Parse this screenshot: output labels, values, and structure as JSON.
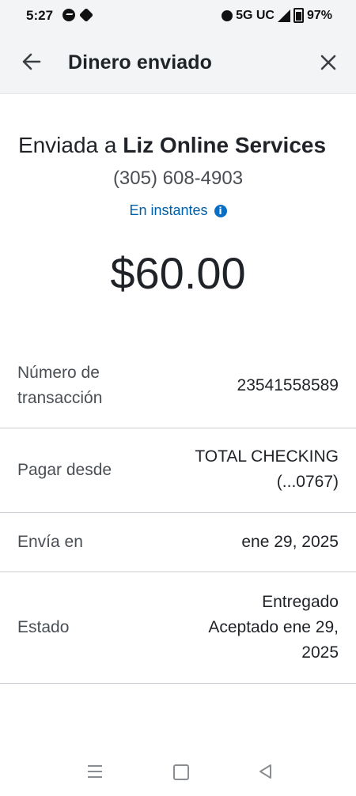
{
  "status_bar": {
    "time": "5:27",
    "network": "5G UC",
    "battery": "97%"
  },
  "header": {
    "title": "Dinero enviado"
  },
  "recipient": {
    "prefix": "Enviada a ",
    "name": "Liz Online Services",
    "phone": "(305) 608-4903",
    "speed": "En instantes",
    "info_icon": "i"
  },
  "amount": "$60.00",
  "details": [
    {
      "label_line1": "Número de",
      "label_line2": "transacción",
      "value": "23541558589"
    },
    {
      "label": "Pagar desde",
      "value_line1": "TOTAL CHECKING",
      "value_line2": "(...0767)"
    },
    {
      "label": "Envía en",
      "value": "ene 29, 2025"
    },
    {
      "label": "Estado",
      "value_line1": "Entregado",
      "value_line2": "Aceptado ene 29,",
      "value_line3": "2025"
    }
  ],
  "colors": {
    "link": "#0060a9",
    "header_bg": "#f3f4f5",
    "divider": "#c9cdd1"
  },
  "icons": [
    "messenger-icon",
    "chase-icon",
    "alarm-icon",
    "signal-icon",
    "battery-icon",
    "back-arrow-icon",
    "close-icon",
    "info-icon",
    "recents-icon",
    "home-icon",
    "back-triangle-icon"
  ]
}
